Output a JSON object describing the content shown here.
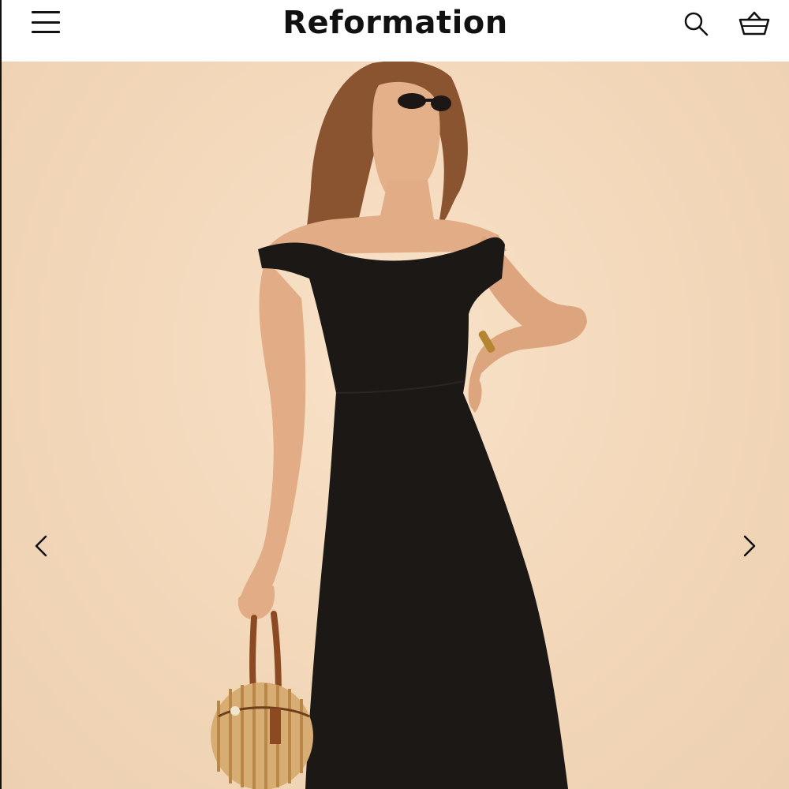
{
  "header": {
    "brand": "Reformation",
    "icons": [
      "menu-icon",
      "search-icon",
      "basket-icon"
    ]
  },
  "gallery": {
    "controls": [
      "chevron-left-icon",
      "chevron-right-icon"
    ]
  },
  "colors": {
    "background": "#f2d6b8",
    "dress": "#1b1816",
    "text": "#111111"
  }
}
